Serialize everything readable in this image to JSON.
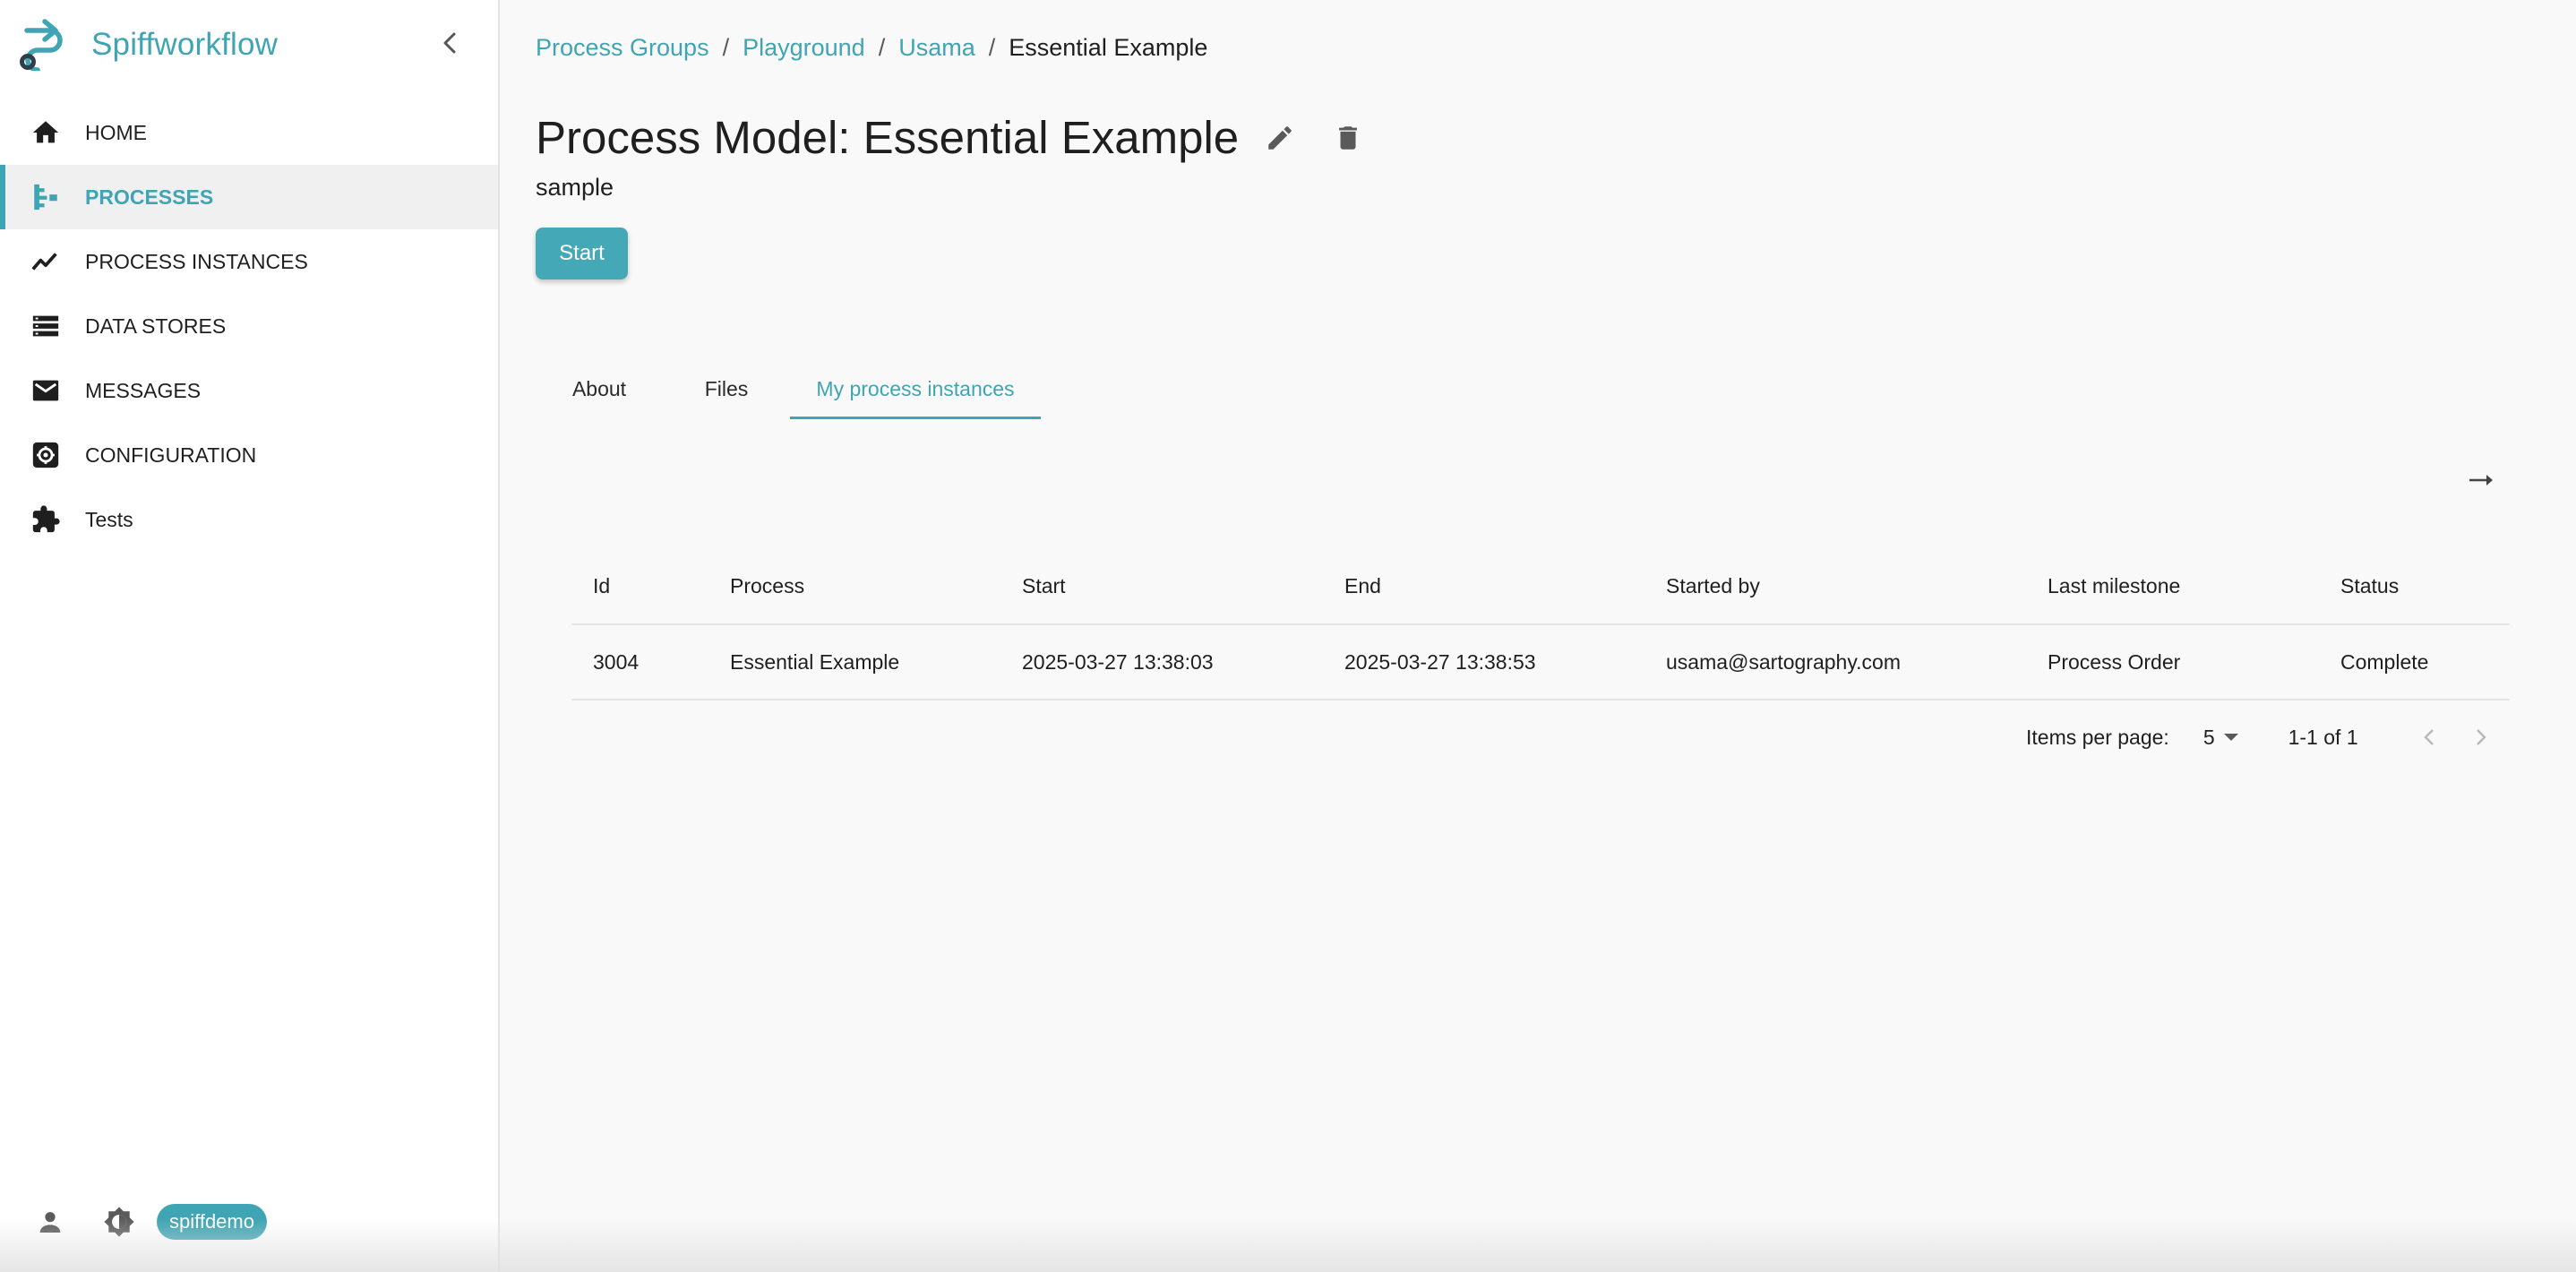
{
  "app": {
    "name": "Spiffworkflow",
    "accent": "#3fa4b3"
  },
  "sidebar": {
    "items": [
      {
        "label": "HOME",
        "icon": "home-icon",
        "active": false
      },
      {
        "label": "PROCESSES",
        "icon": "processes-icon",
        "active": true
      },
      {
        "label": "PROCESS INSTANCES",
        "icon": "trending-icon",
        "active": false
      },
      {
        "label": "DATA STORES",
        "icon": "storage-icon",
        "active": false
      },
      {
        "label": "MESSAGES",
        "icon": "mail-icon",
        "active": false
      },
      {
        "label": "CONFIGURATION",
        "icon": "settings-icon",
        "active": false
      },
      {
        "label": "Tests",
        "icon": "puzzle-icon",
        "active": false
      }
    ],
    "user": {
      "username": "spiffdemo"
    }
  },
  "breadcrumb": {
    "items": [
      "Process Groups",
      "Playground",
      "Usama"
    ],
    "current": "Essential Example",
    "separator": "/"
  },
  "page": {
    "title": "Process Model: Essential Example",
    "subtitle": "sample",
    "start_label": "Start"
  },
  "tabs": [
    {
      "label": "About",
      "active": false
    },
    {
      "label": "Files",
      "active": false
    },
    {
      "label": "My process instances",
      "active": true
    }
  ],
  "table": {
    "columns": [
      "Id",
      "Process",
      "Start",
      "End",
      "Started by",
      "Last milestone",
      "Status"
    ],
    "rows": [
      [
        "3004",
        "Essential Example",
        "2025-03-27 13:38:03",
        "2025-03-27 13:38:53",
        "usama@sartography.com",
        "Process Order",
        "Complete"
      ]
    ]
  },
  "pagination": {
    "items_per_page_label": "Items per page:",
    "items_per_page": "5",
    "range": "1-1 of 1"
  }
}
